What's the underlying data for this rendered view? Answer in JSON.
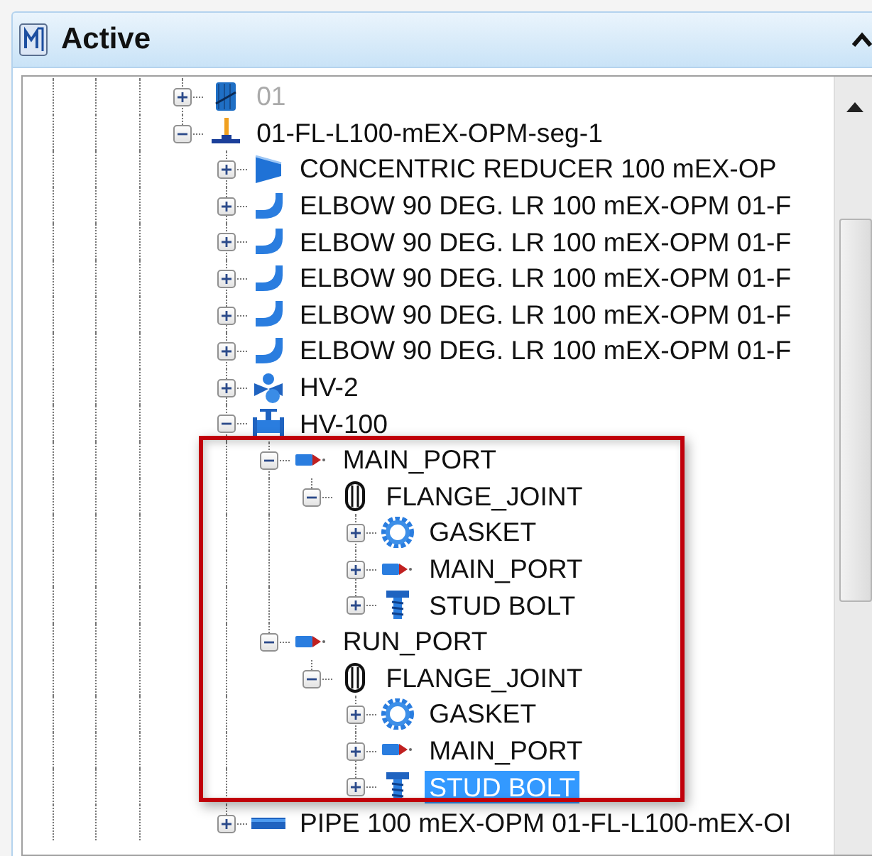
{
  "panel": {
    "title": "Active"
  },
  "tree": [
    {
      "label": "01",
      "kind": "pipeline",
      "expanded": false,
      "dimmed": true,
      "selected": false
    },
    {
      "label": "01-FL-L100-mEX-OPM-seg-1",
      "kind": "run",
      "expanded": true,
      "dimmed": false,
      "selected": false,
      "children": [
        {
          "label": "CONCENTRIC REDUCER 100 mEX-OP",
          "kind": "reducer",
          "expanded": false,
          "dimmed": false,
          "selected": false
        },
        {
          "label": "ELBOW 90 DEG. LR 100 mEX-OPM 01-F",
          "kind": "elbow",
          "expanded": false,
          "dimmed": false,
          "selected": false
        },
        {
          "label": "ELBOW 90 DEG. LR 100 mEX-OPM 01-F",
          "kind": "elbow",
          "expanded": false,
          "dimmed": false,
          "selected": false
        },
        {
          "label": "ELBOW 90 DEG. LR 100 mEX-OPM 01-F",
          "kind": "elbow",
          "expanded": false,
          "dimmed": false,
          "selected": false
        },
        {
          "label": "ELBOW 90 DEG. LR 100 mEX-OPM 01-F",
          "kind": "elbow",
          "expanded": false,
          "dimmed": false,
          "selected": false
        },
        {
          "label": "ELBOW 90 DEG. LR 100 mEX-OPM 01-F",
          "kind": "elbow",
          "expanded": false,
          "dimmed": false,
          "selected": false
        },
        {
          "label": "HV-2",
          "kind": "valve",
          "expanded": false,
          "dimmed": false,
          "selected": false
        },
        {
          "label": "HV-100",
          "kind": "gate",
          "expanded": true,
          "dimmed": false,
          "selected": false,
          "children": [
            {
              "label": "MAIN_PORT",
              "kind": "port",
              "expanded": true,
              "dimmed": false,
              "selected": false,
              "children": [
                {
                  "label": "FLANGE_JOINT",
                  "kind": "flange",
                  "expanded": true,
                  "dimmed": false,
                  "selected": false,
                  "children": [
                    {
                      "label": "GASKET",
                      "kind": "gasket",
                      "expanded": false,
                      "dimmed": false,
                      "selected": false
                    },
                    {
                      "label": "MAIN_PORT",
                      "kind": "port",
                      "expanded": false,
                      "dimmed": false,
                      "selected": false
                    },
                    {
                      "label": "STUD BOLT",
                      "kind": "bolt",
                      "expanded": false,
                      "dimmed": false,
                      "selected": false
                    }
                  ]
                }
              ]
            },
            {
              "label": "RUN_PORT",
              "kind": "port",
              "expanded": true,
              "dimmed": false,
              "selected": false,
              "children": [
                {
                  "label": "FLANGE_JOINT",
                  "kind": "flange",
                  "expanded": true,
                  "dimmed": false,
                  "selected": false,
                  "children": [
                    {
                      "label": "GASKET",
                      "kind": "gasket",
                      "expanded": false,
                      "dimmed": false,
                      "selected": false
                    },
                    {
                      "label": "MAIN_PORT",
                      "kind": "port",
                      "expanded": false,
                      "dimmed": false,
                      "selected": false
                    },
                    {
                      "label": "STUD BOLT",
                      "kind": "bolt",
                      "expanded": false,
                      "dimmed": false,
                      "selected": true
                    }
                  ]
                }
              ]
            }
          ]
        },
        {
          "label": "PIPE 100 mEX-OPM 01-FL-L100-mEX-OI",
          "kind": "pipe",
          "expanded": false,
          "dimmed": false,
          "selected": false
        }
      ]
    }
  ]
}
